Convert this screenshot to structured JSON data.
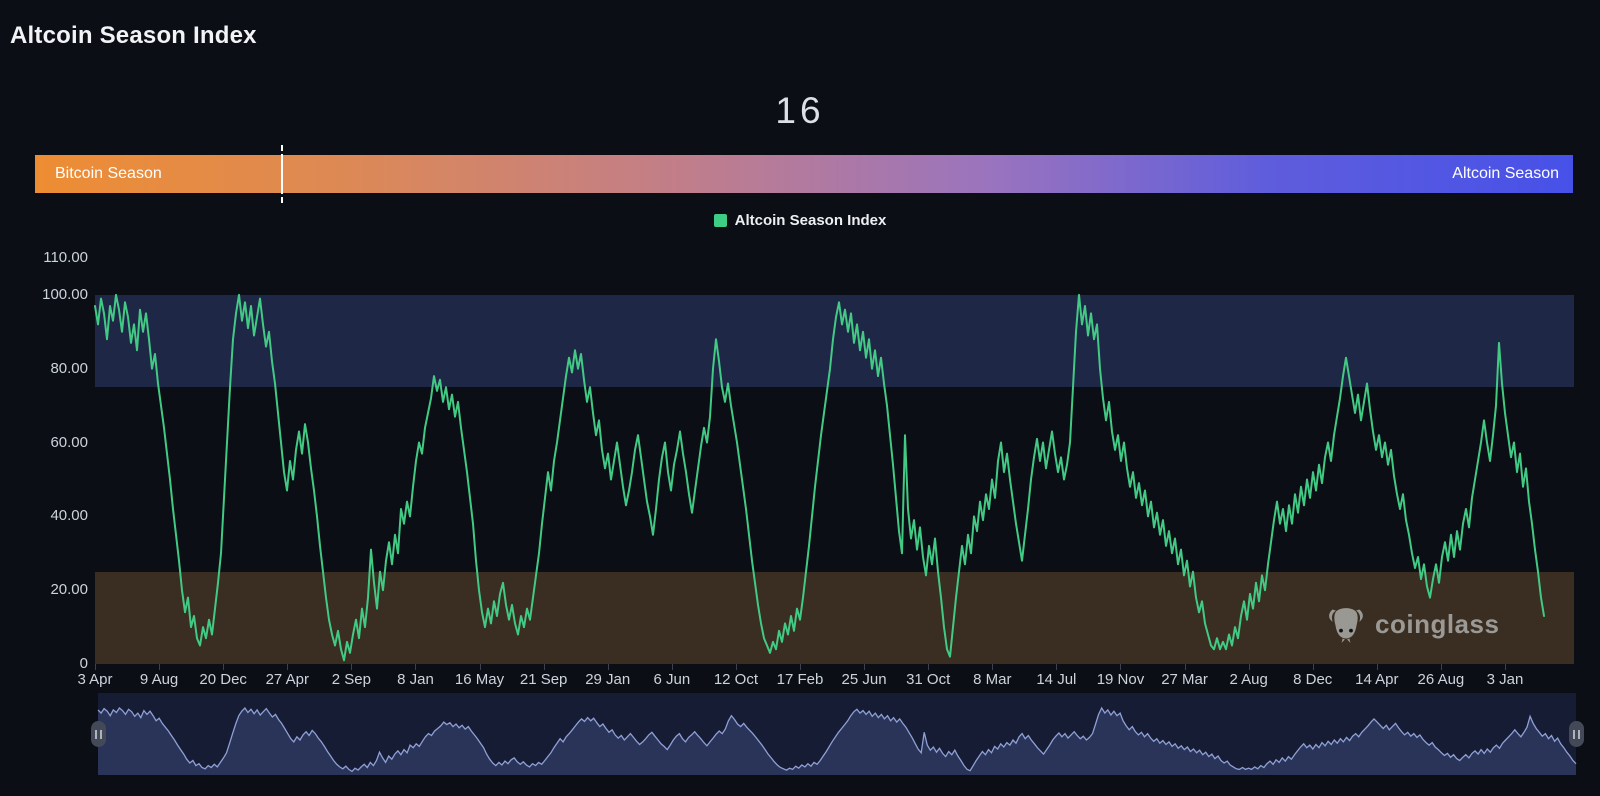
{
  "page": {
    "title": "Altcoin Season Index"
  },
  "index": {
    "value": 16
  },
  "season_bar": {
    "left_label": "Bitcoin Season",
    "right_label": "Altcoin Season",
    "gradient_start_color": "#ED8D33",
    "gradient_end_color": "#4751E8",
    "marker_color": "#FFFFFF"
  },
  "legend": {
    "label": "Altcoin Season Index",
    "swatch_color": "#3ECD85"
  },
  "watermark": {
    "text": "coinglass",
    "icon": "coinglass-bull-icon",
    "color": "#A9A9A6"
  },
  "navigator": {
    "bg_color": "#161C33",
    "fill_color": "#2A3459",
    "line_color": "#8FA0D6"
  },
  "chart_data": {
    "type": "line",
    "title": "Altcoin Season Index",
    "series": [
      {
        "name": "Altcoin Season Index",
        "color": "#42CA85"
      }
    ],
    "ylim": [
      0,
      110
    ],
    "grid": false,
    "legend_position": "top-center",
    "y_ticks": [
      {
        "label": "110.00",
        "value": 110
      },
      {
        "label": "100.00",
        "value": 100
      },
      {
        "label": "80.00",
        "value": 80
      },
      {
        "label": "60.00",
        "value": 60
      },
      {
        "label": "40.00",
        "value": 40
      },
      {
        "label": "20.00",
        "value": 20
      },
      {
        "label": "0",
        "value": 0
      }
    ],
    "x_ticks": [
      "3 Apr",
      "9 Aug",
      "20 Dec",
      "27 Apr",
      "2 Sep",
      "8 Jan",
      "16 May",
      "21 Sep",
      "29 Jan",
      "6 Jun",
      "12 Oct",
      "17 Feb",
      "25 Jun",
      "31 Oct",
      "8 Mar",
      "14 Jul",
      "19 Nov",
      "27 Mar",
      "2 Aug",
      "8 Dec",
      "14 Apr",
      "26 Aug",
      "3 Jan"
    ],
    "bands": [
      {
        "name": "altcoin-season-zone",
        "from": 75,
        "to": 100,
        "color": "#1F2746"
      },
      {
        "name": "bitcoin-season-zone",
        "from": 0,
        "to": 25,
        "color": "#3A2D21"
      }
    ],
    "values": [
      97,
      92,
      99,
      95,
      88,
      97,
      93,
      100,
      96,
      90,
      98,
      94,
      87,
      92,
      85,
      96,
      90,
      95,
      88,
      80,
      84,
      76,
      70,
      64,
      57,
      50,
      42,
      35,
      28,
      20,
      14,
      18,
      10,
      13,
      7,
      5,
      10,
      7,
      12,
      8,
      15,
      22,
      30,
      45,
      60,
      75,
      88,
      95,
      100,
      93,
      98,
      91,
      97,
      89,
      94,
      99,
      92,
      86,
      90,
      82,
      76,
      68,
      60,
      52,
      47,
      55,
      50,
      58,
      63,
      57,
      65,
      60,
      53,
      47,
      40,
      32,
      25,
      18,
      12,
      8,
      5,
      9,
      4,
      1,
      6,
      3,
      8,
      12,
      7,
      15,
      10,
      18,
      31,
      22,
      15,
      25,
      20,
      28,
      33,
      27,
      35,
      30,
      42,
      38,
      44,
      40,
      48,
      55,
      60,
      57,
      64,
      68,
      72,
      78,
      74,
      77,
      71,
      75,
      69,
      73,
      67,
      71,
      64,
      58,
      52,
      45,
      38,
      28,
      20,
      14,
      10,
      15,
      11,
      17,
      13,
      19,
      22,
      16,
      12,
      16,
      11,
      8,
      13,
      10,
      15,
      12,
      18,
      24,
      30,
      38,
      45,
      52,
      47,
      55,
      60,
      66,
      72,
      78,
      83,
      79,
      85,
      80,
      84,
      77,
      71,
      75,
      68,
      62,
      66,
      58,
      53,
      57,
      50,
      55,
      60,
      54,
      48,
      43,
      47,
      52,
      58,
      62,
      56,
      50,
      44,
      40,
      35,
      42,
      50,
      56,
      60,
      52,
      47,
      54,
      58,
      63,
      57,
      52,
      46,
      41,
      47,
      53,
      59,
      64,
      60,
      67,
      80,
      88,
      82,
      75,
      71,
      76,
      70,
      65,
      60,
      54,
      48,
      42,
      35,
      28,
      22,
      16,
      11,
      7,
      5,
      3,
      6,
      4,
      9,
      6,
      11,
      8,
      13,
      9,
      15,
      12,
      18,
      25,
      32,
      40,
      48,
      55,
      62,
      68,
      74,
      80,
      88,
      94,
      98,
      92,
      96,
      90,
      95,
      87,
      92,
      85,
      90,
      83,
      88,
      80,
      85,
      78,
      83,
      76,
      70,
      62,
      54,
      45,
      36,
      30,
      62,
      42,
      34,
      39,
      31,
      37,
      29,
      24,
      32,
      27,
      34,
      25,
      18,
      10,
      4,
      2,
      10,
      18,
      25,
      32,
      27,
      35,
      30,
      40,
      36,
      44,
      39,
      46,
      42,
      50,
      45,
      55,
      60,
      52,
      57,
      50,
      44,
      38,
      33,
      28,
      35,
      42,
      50,
      56,
      61,
      55,
      60,
      53,
      58,
      63,
      57,
      52,
      56,
      50,
      54,
      60,
      75,
      90,
      100,
      92,
      97,
      89,
      95,
      88,
      92,
      80,
      72,
      66,
      71,
      63,
      58,
      62,
      55,
      60,
      53,
      48,
      52,
      45,
      49,
      43,
      47,
      40,
      44,
      37,
      41,
      35,
      39,
      32,
      36,
      30,
      34,
      27,
      31,
      24,
      28,
      21,
      25,
      18,
      14,
      17,
      11,
      8,
      5,
      4,
      7,
      4,
      6,
      4,
      8,
      5,
      10,
      7,
      13,
      17,
      12,
      19,
      15,
      22,
      17,
      24,
      20,
      27,
      33,
      39,
      44,
      38,
      42,
      36,
      43,
      38,
      46,
      41,
      48,
      43,
      50,
      45,
      52,
      47,
      54,
      49,
      56,
      60,
      55,
      62,
      67,
      72,
      78,
      83,
      78,
      73,
      68,
      73,
      66,
      71,
      76,
      69,
      63,
      58,
      62,
      56,
      60,
      54,
      58,
      51,
      46,
      42,
      46,
      39,
      35,
      30,
      26,
      29,
      23,
      27,
      21,
      18,
      23,
      27,
      22,
      29,
      33,
      28,
      35,
      29,
      36,
      31,
      38,
      42,
      37,
      45,
      50,
      55,
      60,
      66,
      60,
      55,
      62,
      70,
      87,
      76,
      68,
      62,
      56,
      60,
      52,
      57,
      48,
      53,
      44,
      38,
      31,
      25,
      18,
      13
    ]
  }
}
